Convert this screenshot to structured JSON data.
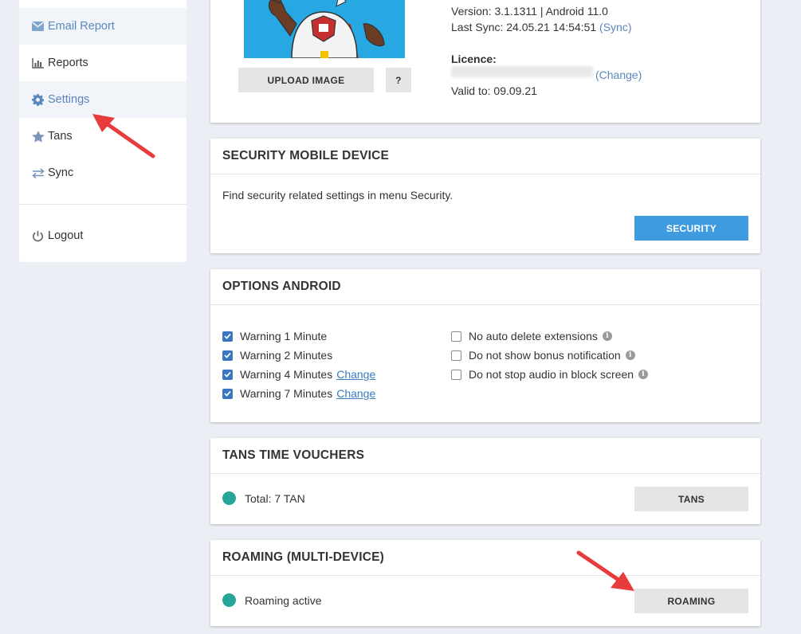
{
  "sidebar": {
    "items": [
      {
        "label": "Email Report",
        "icon": "envelope-icon",
        "active": true
      },
      {
        "label": "Reports",
        "icon": "bar-chart-icon",
        "active": false
      },
      {
        "label": "Settings",
        "icon": "gear-icon",
        "active": true
      },
      {
        "label": "Tans",
        "icon": "star-icon",
        "active": false
      },
      {
        "label": "Sync",
        "icon": "sync-arrows-icon",
        "active": false
      }
    ],
    "logout_label": "Logout"
  },
  "device": {
    "version_line": "Version: 3.1.1311 | Android 11.0",
    "last_sync_prefix": "Last Sync: 24.05.21 14:54:51",
    "sync_link": "(Sync)",
    "licence_label": "Licence:",
    "change_link": "(Change)",
    "valid_to": "Valid to: 09.09.21",
    "upload_button": "UPLOAD IMAGE",
    "help_button": "?"
  },
  "security_card": {
    "title": "SECURITY MOBILE DEVICE",
    "text": "Find security related settings in menu Security.",
    "button": "SECURITY"
  },
  "options_card": {
    "title": "OPTIONS ANDROID",
    "left": [
      {
        "label": "Warning 1 Minute",
        "checked": true,
        "link": ""
      },
      {
        "label": "Warning 2 Minutes",
        "checked": true,
        "link": ""
      },
      {
        "label": "Warning 4 Minutes",
        "checked": true,
        "link": "Change"
      },
      {
        "label": "Warning 7 Minutes",
        "checked": true,
        "link": "Change"
      }
    ],
    "right": [
      {
        "label": "No auto delete extensions",
        "checked": false
      },
      {
        "label": "Do not show bonus notification",
        "checked": false
      },
      {
        "label": "Do not stop audio in block screen",
        "checked": false
      }
    ]
  },
  "tans_card": {
    "title": "TANS TIME VOUCHERS",
    "status": "Total: 7 TAN",
    "button": "TANS"
  },
  "roaming_card": {
    "title": "ROAMING (MULTI-DEVICE)",
    "status": "Roaming active",
    "button": "ROAMING"
  },
  "colors": {
    "accent_blue": "#3f9be0",
    "link_blue": "#3a7cc0",
    "status_green": "#26a69a",
    "annotation_red": "#e83b3b"
  }
}
